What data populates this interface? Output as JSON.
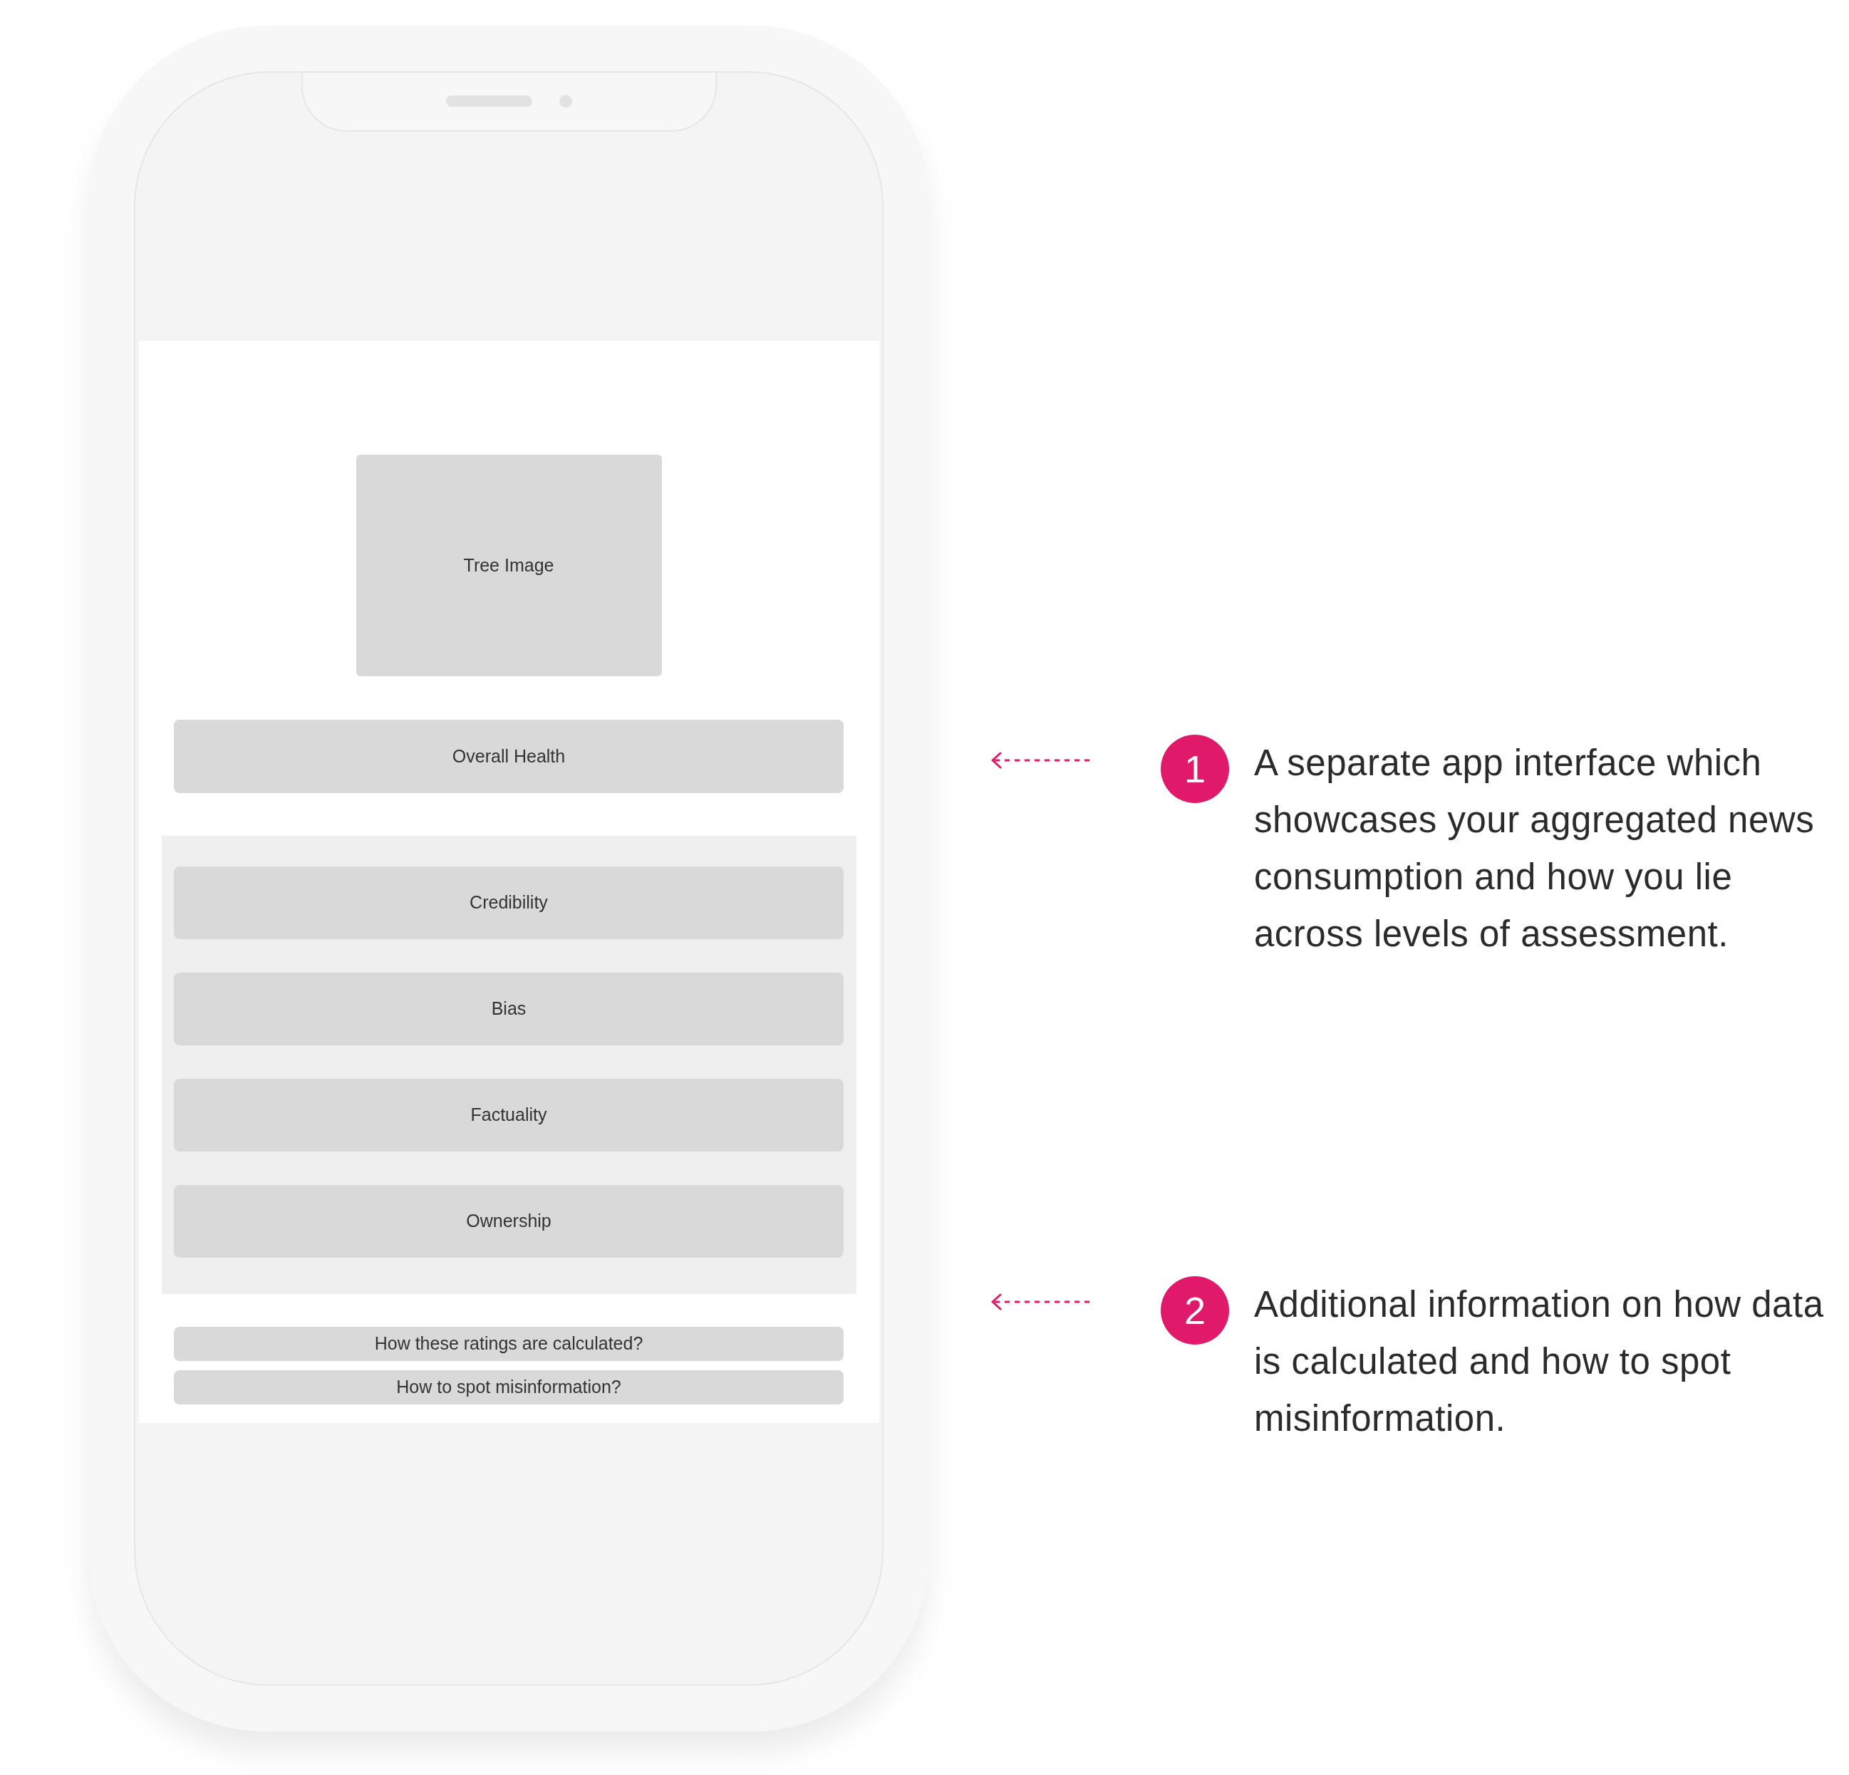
{
  "phone": {
    "image_placeholder": "Tree Image",
    "overall_button": "Overall Health",
    "category_buttons": [
      "Credibility",
      "Bias",
      "Factuality",
      "Ownership"
    ],
    "link_buttons": [
      "How these ratings are calculated?",
      "How to spot misinformation?"
    ]
  },
  "annotations": [
    {
      "number": "1",
      "text": "A separate app interface which showcases your aggregated news consumption and how you lie across levels of assessment."
    },
    {
      "number": "2",
      "text": "Additional information on how data is calculated and how to spot misinformation."
    }
  ]
}
